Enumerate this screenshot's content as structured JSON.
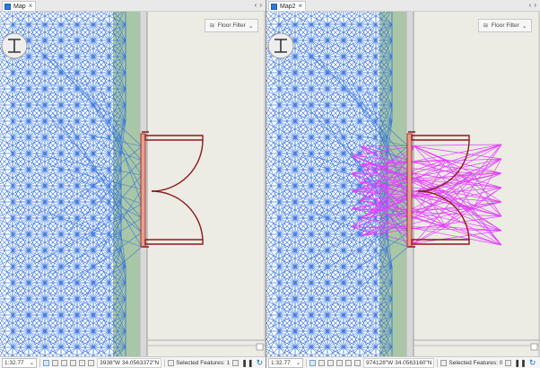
{
  "left_pane": {
    "tab_label": "Map",
    "floor_filter_label": "Floor Filter",
    "status": {
      "scale": "1:32.77",
      "coordinates": "3938\"W 34.0563372\"N",
      "selected_features": "Selected Features: 1"
    }
  },
  "right_pane": {
    "tab_label": "Map2",
    "floor_filter_label": "Floor Filter",
    "status": {
      "scale": "1:32.77",
      "coordinates": "974128\"W 34.0563160\"N",
      "selected_features": "Selected Features: 0"
    }
  },
  "glyphs": {
    "close": "×",
    "prev": "‹",
    "next": "›",
    "dropdown": "⌄",
    "pause": "❚❚",
    "refresh": "↻",
    "floor_filter_icon": "≋"
  },
  "colors": {
    "network_lines": "#2f6fdc",
    "selected_network": "#e040fb",
    "door_outline": "#8b1a1a",
    "door_frame": "#e8a08a",
    "green_corridor": "#a9c7a6",
    "floor_background": "#ecebe4",
    "wall": "#d8d8d8"
  }
}
